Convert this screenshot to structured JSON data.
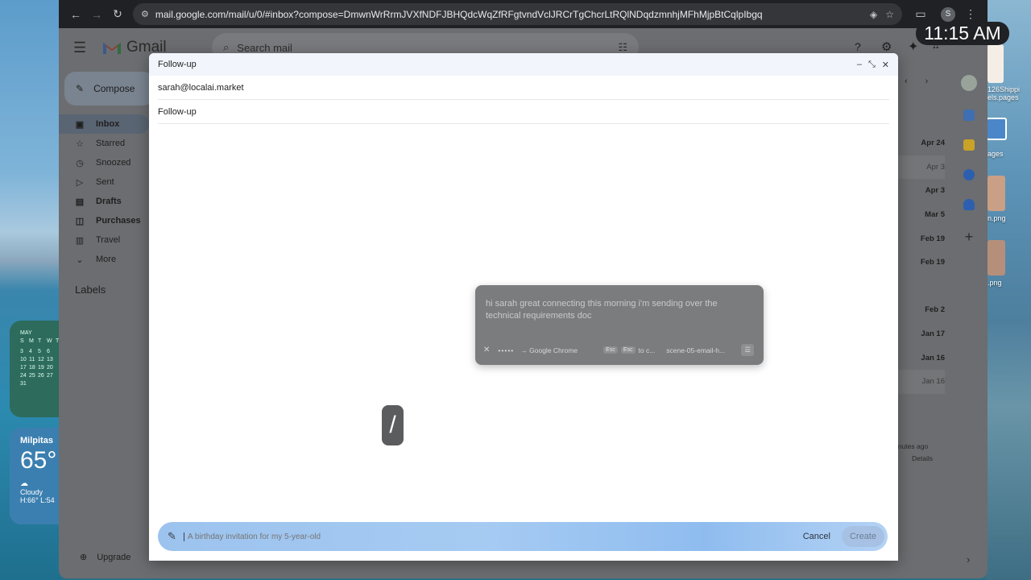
{
  "browser": {
    "url": "mail.google.com/mail/u/0/#inbox?compose=DmwnWrRrmJVXfNDFJBHQdcWqZfRFgtvndVclJRCrTgChcrLtRQlNDqdzmnhjMFhMjpBtCqlpIbgq",
    "profile_initial": "S"
  },
  "clock": "11:15 AM",
  "gmail": {
    "app_name": "Gmail",
    "search_placeholder": "Search mail",
    "compose_label": "Compose",
    "nav": [
      {
        "label": "Inbox",
        "icon": "inbox-icon"
      },
      {
        "label": "Starred",
        "icon": "star-icon"
      },
      {
        "label": "Snoozed",
        "icon": "clock-icon"
      },
      {
        "label": "Sent",
        "icon": "send-icon"
      },
      {
        "label": "Drafts",
        "icon": "draft-icon"
      },
      {
        "label": "Purchases",
        "icon": "bag-icon"
      },
      {
        "label": "Travel",
        "icon": "luggage-icon"
      },
      {
        "label": "More",
        "icon": "chevron-down-icon"
      }
    ],
    "labels_heading": "Labels",
    "upgrade_label": "Upgrade",
    "dates": [
      "Apr 24",
      "Apr 3",
      "Apr 3",
      "Mar 5",
      "Feb 19",
      "Feb 19",
      "",
      "Feb 2",
      "Jan 17",
      "Jan 16",
      "Jan 16"
    ],
    "activity_note": "inutes ago",
    "details_link": "Details"
  },
  "compose": {
    "title": "Follow-up",
    "to": "sarah@localai.market",
    "subject": "Follow-up"
  },
  "dictation_popup": {
    "text": "hi sarah great connecting this morning i'm sending over the technical requirements doc",
    "target_app": "→ Google Chrome",
    "key1": "Esc",
    "key2": "Esc",
    "key_hint": "to c...",
    "context": "scene-05-email-h..."
  },
  "cursor_glyph": "/",
  "help_me_write": {
    "placeholder": "A birthday invitation for my 5-year-old",
    "cancel_label": "Cancel",
    "create_label": "Create"
  },
  "desktop": {
    "calendar_month": "MAY",
    "calendar_days_header": [
      "S",
      "M",
      "T",
      "W",
      "T"
    ],
    "calendar_rows": [
      [
        "",
        "",
        "",
        "",
        ""
      ],
      [
        "3",
        "4",
        "5",
        "6",
        ""
      ],
      [
        "10",
        "11",
        "12",
        "13",
        ""
      ],
      [
        "17",
        "18",
        "19",
        "20",
        ""
      ],
      [
        "24",
        "25",
        "26",
        "27",
        ""
      ],
      [
        "31",
        "",
        "",
        "",
        ""
      ]
    ],
    "weather_city": "Milpitas",
    "weather_temp": "65°",
    "weather_condition": "Cloudy",
    "weather_hilo": "H:66° L:54",
    "file1_line1": "126Shippi",
    "file1_line2": "els.pages",
    "file2": "ages",
    "file3": "n.png",
    "file4": ".png"
  }
}
